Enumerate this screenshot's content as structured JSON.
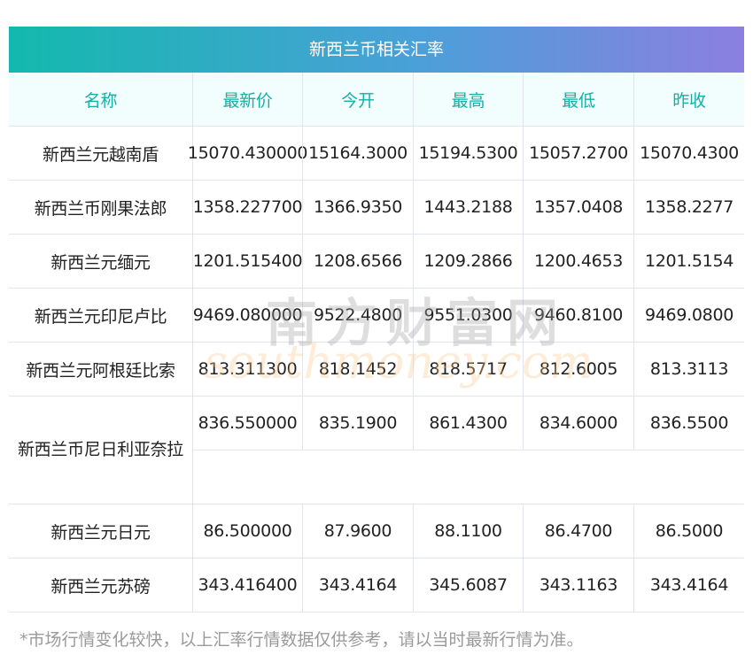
{
  "title": "新西兰币相关汇率",
  "columns": [
    "名称",
    "最新价",
    "今开",
    "最高",
    "最低",
    "昨收"
  ],
  "rows": [
    [
      "新西兰元越南盾",
      "15070.430000",
      "15164.3000",
      "15194.5300",
      "15057.2700",
      "15070.4300"
    ],
    [
      "新西兰币刚果法郎",
      "1358.227700",
      "1366.9350",
      "1443.2188",
      "1357.0408",
      "1358.2277"
    ],
    [
      "新西兰元缅元",
      "1201.515400",
      "1208.6566",
      "1209.2866",
      "1200.4653",
      "1201.5154"
    ],
    [
      "新西兰元印尼卢比",
      "9469.080000",
      "9522.4800",
      "9551.0300",
      "9460.8100",
      "9469.0800"
    ],
    [
      "新西兰元阿根廷比索",
      "813.311300",
      "818.1452",
      "818.5717",
      "812.6005",
      "813.3113"
    ],
    [
      "新西兰币尼日利亚奈拉",
      "836.550000",
      "835.1900",
      "861.4300",
      "834.6000",
      "836.5500"
    ],
    [
      "新西兰元日元",
      "86.500000",
      "87.9600",
      "88.1100",
      "86.4700",
      "86.5000"
    ],
    [
      "新西兰元苏磅",
      "343.416400",
      "343.4164",
      "345.6087",
      "343.1163",
      "343.4164"
    ]
  ],
  "watermark": {
    "cn": "南方财富网",
    "en": "southmoney.com"
  },
  "footnote": "*市场行情变化较快，以上汇率行情数据仅供参考，请以当时最新行情为准。"
}
